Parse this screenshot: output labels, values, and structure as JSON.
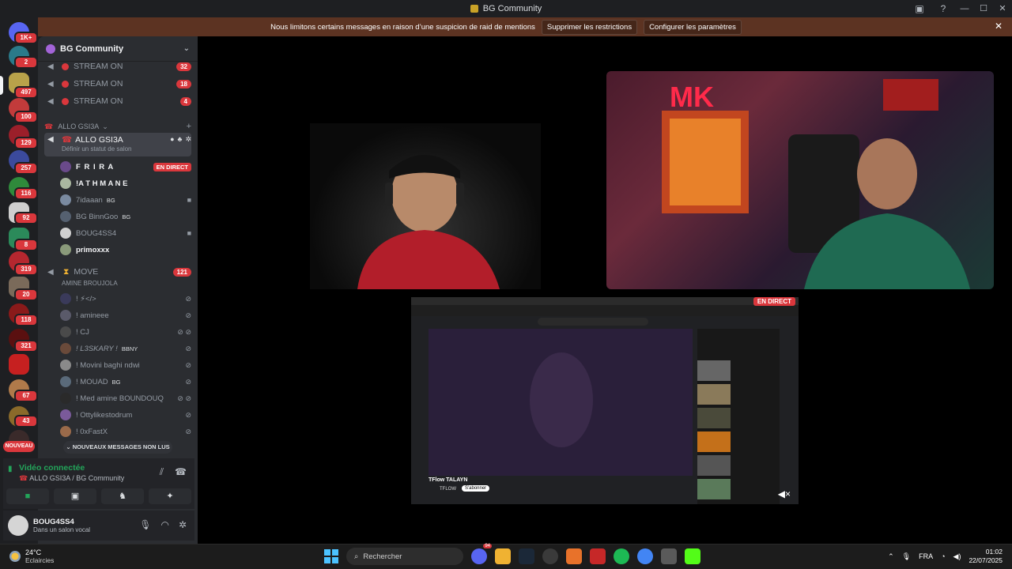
{
  "window": {
    "title": "BG Community"
  },
  "notice": {
    "text": "Nous limitons certains messages en raison d’une suspicion de raid de mentions",
    "btn1": "Supprimer les restrictions",
    "btn2": "Configurer les paramètres"
  },
  "rail": {
    "badges": [
      "1K+",
      "2",
      "497",
      "100",
      "129",
      "257",
      "116",
      "92",
      "8",
      "319",
      "20",
      "118",
      "321",
      "67",
      "43"
    ],
    "nouveau": "NOUVEAU"
  },
  "server": {
    "name": "BG Community"
  },
  "channels": {
    "streams": [
      {
        "label": "STREAM ON",
        "badge": "32"
      },
      {
        "label": "STREAM ON",
        "badge": "18"
      },
      {
        "label": "STREAM ON",
        "badge": "4"
      }
    ],
    "category": "ALLO GSI3A",
    "active": {
      "label": "ALLO GSI3A",
      "status": "Définir un statut de salon"
    },
    "voice_users": [
      {
        "name": "F R I R A",
        "live": "EN DIRECT"
      },
      {
        "name": "!A T H M A N E"
      },
      {
        "name": "7idaaan",
        "tag": "BG"
      },
      {
        "name": "BG BinnGoo",
        "tag": "BG"
      },
      {
        "name": "BOUG4SS4"
      },
      {
        "name": "primoxxx"
      }
    ],
    "move": {
      "label": "MOVE",
      "badge": "121",
      "sub": "AMINE BROUJOLA"
    },
    "move_users": [
      {
        "name": "! ⚡</>"
      },
      {
        "name": "! amineee"
      },
      {
        "name": "! CJ"
      },
      {
        "name": "! L3SKARY !",
        "tag": "BBNY"
      },
      {
        "name": "! Movini baghi ndwi"
      },
      {
        "name": "! MOUAD",
        "tag": "BG"
      },
      {
        "name": "! Med amine BOUNDOUQ"
      },
      {
        "name": "! Ottylikestodrum"
      },
      {
        "name": "! 0xFastX"
      }
    ],
    "new_messages": "NOUVEAUX MESSAGES NON LUS"
  },
  "voice": {
    "status": "Vidéo connectée",
    "channel": "ALLO GSI3A / BG Community"
  },
  "user": {
    "name": "BOUG4SS4",
    "sub": "Dans un salon vocal"
  },
  "stage": {
    "live": "EN DIRECT",
    "yt_title": "TFlow TALAYN",
    "yt_channel": "TFLOW",
    "yt_subscribe": "S'abonner"
  },
  "taskbar": {
    "temp": "24°C",
    "weather": "Eclaircies",
    "search": "Rechercher",
    "lang": "FRA",
    "time": "01:02",
    "date": "22/07/2025",
    "discord_badge": "94"
  },
  "colors": {
    "accent_red": "#da373c",
    "online_green": "#23a55a",
    "sidebar": "#2b2d31"
  }
}
